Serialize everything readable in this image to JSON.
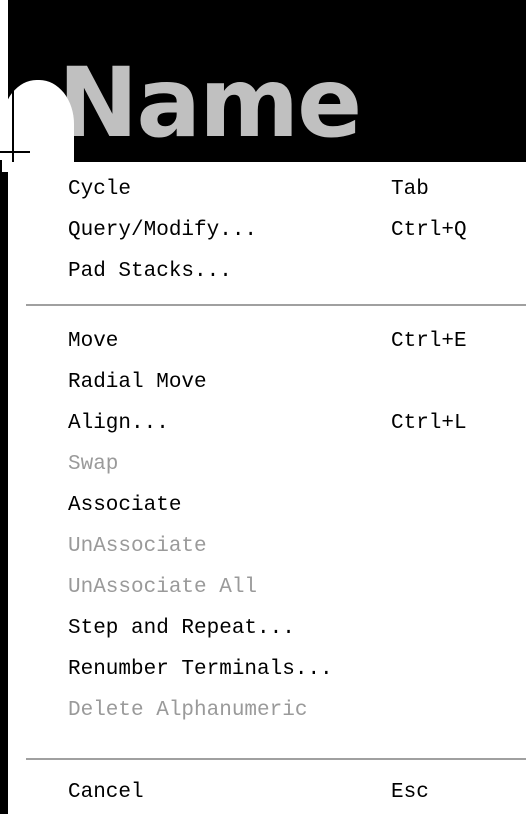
{
  "background": {
    "visible_text": "Name"
  },
  "menu": {
    "items": [
      {
        "label": "Cycle",
        "shortcut": "Tab",
        "disabled": false
      },
      {
        "label": "Query/Modify...",
        "shortcut": "Ctrl+Q",
        "disabled": false
      },
      {
        "label": "Pad Stacks...",
        "shortcut": "",
        "disabled": false
      },
      {
        "label": "Move",
        "shortcut": "Ctrl+E",
        "disabled": false
      },
      {
        "label": "Radial Move",
        "shortcut": "",
        "disabled": false
      },
      {
        "label": "Align...",
        "shortcut": "Ctrl+L",
        "disabled": false
      },
      {
        "label": "Swap",
        "shortcut": "",
        "disabled": true
      },
      {
        "label": "Associate",
        "shortcut": "",
        "disabled": false
      },
      {
        "label": "UnAssociate",
        "shortcut": "",
        "disabled": true
      },
      {
        "label": "UnAssociate All",
        "shortcut": "",
        "disabled": true
      },
      {
        "label": "Step and Repeat...",
        "shortcut": "",
        "disabled": false
      },
      {
        "label": "Renumber Terminals...",
        "shortcut": "",
        "disabled": false
      },
      {
        "label": "Delete Alphanumeric",
        "shortcut": "",
        "disabled": true
      },
      {
        "label": "Cancel",
        "shortcut": "Esc",
        "disabled": false
      }
    ]
  },
  "colors": {
    "menu_background": "#ffffff",
    "enabled_text": "#000000",
    "disabled_text": "#9a9a9a",
    "canvas_background": "#000000",
    "background_text": "#c0c0c0"
  }
}
